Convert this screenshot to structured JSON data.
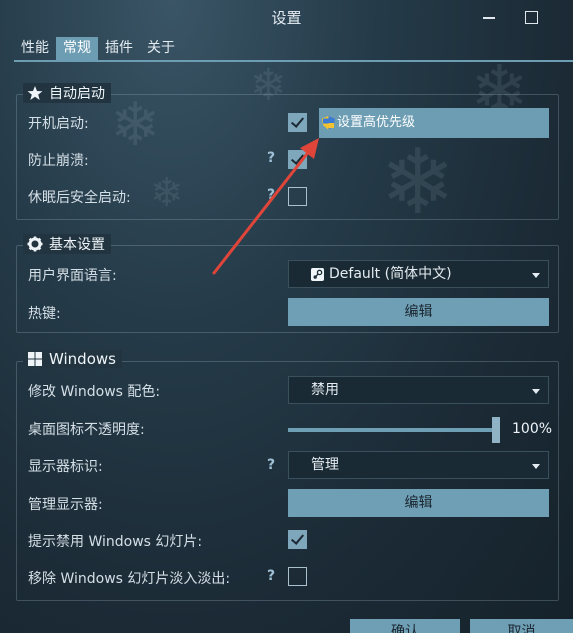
{
  "window": {
    "title": "设置"
  },
  "tabs": [
    {
      "label": "性能"
    },
    {
      "label": "常规"
    },
    {
      "label": "插件"
    },
    {
      "label": "关于"
    }
  ],
  "autostart": {
    "title": "自动启动",
    "boot": {
      "label": "开机启动:",
      "checked": true
    },
    "crash": {
      "label": "防止崩溃:",
      "help": "?",
      "checked": true
    },
    "sleep": {
      "label": "休眠后安全启动:",
      "help": "?",
      "checked": false
    },
    "tooltip": "设置高优先级"
  },
  "basic": {
    "title": "基本设置",
    "language": {
      "label": "用户界面语言:",
      "value": "Default (简体中文)"
    },
    "hotkey": {
      "label": "热键:",
      "button": "编辑"
    }
  },
  "windows": {
    "title": "Windows",
    "color": {
      "label": "修改 Windows 配色:",
      "value": "禁用"
    },
    "opacity": {
      "label": "桌面图标不透明度:",
      "value": 100,
      "display": "100%"
    },
    "monitor_id": {
      "label": "显示器标识:",
      "help": "?",
      "value": "管理"
    },
    "manage_monitors": {
      "label": "管理显示器:",
      "button": "编辑"
    },
    "slideshow_hint": {
      "label": "提示禁用 Windows 幻灯片:",
      "checked": true
    },
    "slideshow_fade": {
      "label": "移除 Windows 幻灯片淡入淡出:",
      "help": "?",
      "checked": false
    }
  },
  "footer": {
    "ok": "确认",
    "cancel": "取消"
  },
  "colors": {
    "accent": "#6f9fb5",
    "arrow": "#e0453a"
  }
}
